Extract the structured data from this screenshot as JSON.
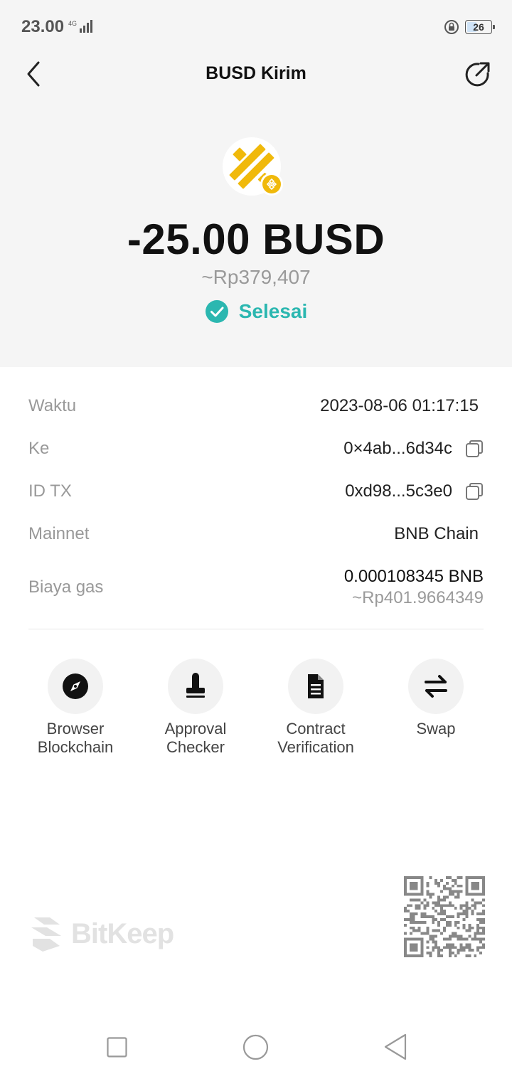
{
  "status_bar": {
    "time": "23.00",
    "network": "4G",
    "battery": "26"
  },
  "header": {
    "title": "BUSD Kirim"
  },
  "hero": {
    "amount": "-25.00 BUSD",
    "fiat_value": "~Rp379,407",
    "status": "Selesai",
    "status_color": "#2bb7b0",
    "token_color": "#f0b90b"
  },
  "details": [
    {
      "label": "Waktu",
      "value": "2023-08-06 01:17:15"
    },
    {
      "label": "Ke",
      "value": "0×4ab...6d34c"
    },
    {
      "label": "ID TX",
      "value": "0xd98...5c3e0"
    },
    {
      "label": "Mainnet",
      "value": "BNB Chain"
    },
    {
      "label": "Biaya gas",
      "value": "0.000108345 BNB",
      "sub": "~Rp401.9664349"
    }
  ],
  "tools": [
    {
      "label": "Browser Blockchain",
      "icon": "compass-icon"
    },
    {
      "label": "Approval Checker",
      "icon": "stamp-icon"
    },
    {
      "label": "Contract Verification",
      "icon": "document-icon"
    },
    {
      "label": "Swap",
      "icon": "swap-arrows-icon"
    }
  ],
  "brand": {
    "name": "BitKeep"
  }
}
